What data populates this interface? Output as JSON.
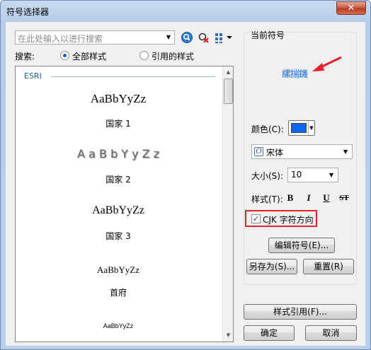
{
  "window": {
    "title": "符号选择器",
    "close_glyph": "✕"
  },
  "search": {
    "placeholder": "在此处输入以进行搜索",
    "label": "搜索:",
    "scope_options": [
      {
        "label": "全部样式",
        "selected": true
      },
      {
        "label": "引用的样式",
        "selected": false
      }
    ]
  },
  "toolbar_icons": [
    "search-icon",
    "clear-search-icon",
    "view-options-icon"
  ],
  "symbol_list": {
    "group_header": "ESRI",
    "items": [
      {
        "sample": "AaBbYyZz",
        "name": "国家 1"
      },
      {
        "sample": "A a B b Y y Z z",
        "name": "国家 2"
      },
      {
        "sample": "AaBbYyZz",
        "name": "国家 3"
      },
      {
        "sample": "AaBbYyZz",
        "name": "首府"
      },
      {
        "sample": "AaBbYyZz",
        "name": ""
      }
    ]
  },
  "current_symbol": {
    "title": "当前符号",
    "preview_text": "縲揣鐖",
    "color_label": "颜色(C):",
    "color_value": "#0b68f0",
    "font_value": "宋体",
    "size_label": "大小(S):",
    "size_value": "10",
    "style_label": "样式(T):",
    "style_buttons": [
      "B",
      "I",
      "U",
      "ST"
    ],
    "cjk_label": "CJK 字符方向",
    "cjk_checked": true,
    "edit_button": "编辑符号(E)...",
    "save_as_button": "另存为(S)...",
    "reset_button": "重置(R)"
  },
  "footer": {
    "style_refs_button": "样式引用(F)...",
    "ok_button": "确定",
    "cancel_button": "取消"
  },
  "accent_colors": {
    "highlight_box": "#e6202a",
    "preview_text": "#1b6fd6"
  }
}
